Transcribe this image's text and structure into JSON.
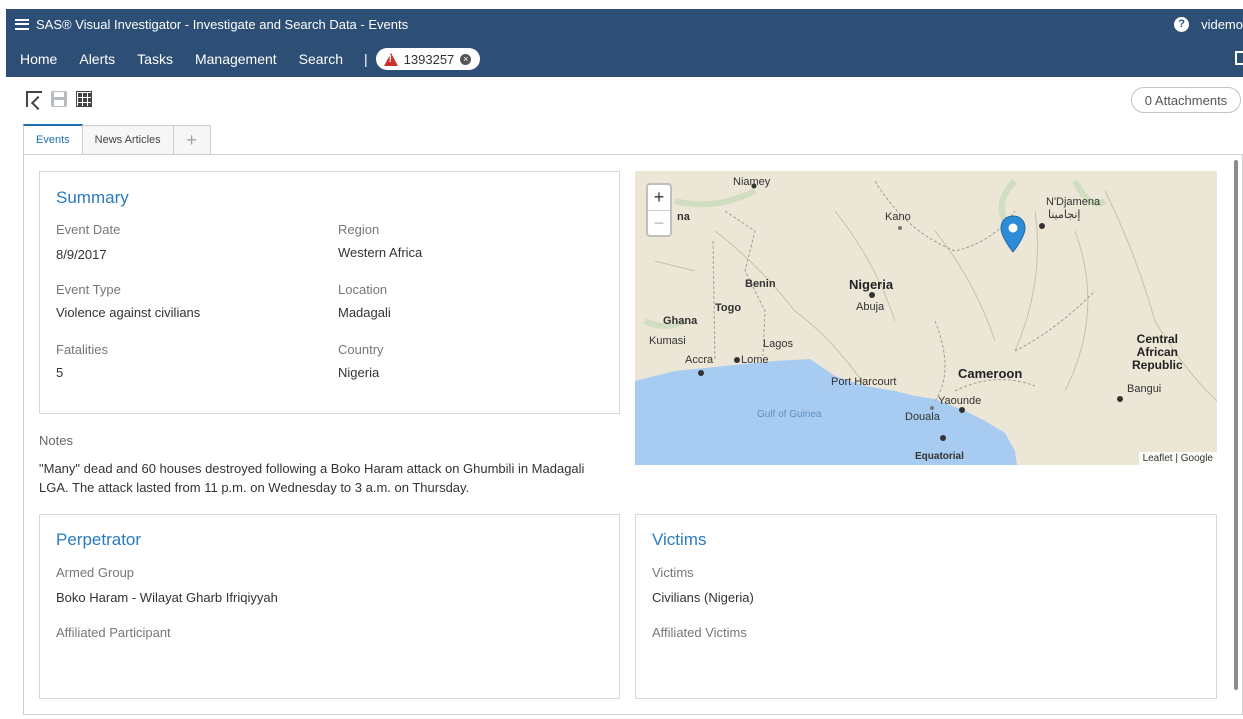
{
  "window": {
    "title": "SAS® Visual Investigator - Investigate and Search Data - Events"
  },
  "user": {
    "name": "videmo"
  },
  "nav": {
    "items": [
      "Home",
      "Alerts",
      "Tasks",
      "Management",
      "Search"
    ],
    "separator": "|",
    "case_number": "1393257"
  },
  "toolbar": {
    "icons": [
      "select-icon",
      "save-icon",
      "layout-icon"
    ]
  },
  "attachments": {
    "label": "0 Attachments"
  },
  "tabs": {
    "items": [
      "Events",
      "News Articles"
    ],
    "active": "Events",
    "add": "+"
  },
  "summary": {
    "title": "Summary",
    "event_date_label": "Event Date",
    "event_date": "8/9/2017",
    "event_type_label": "Event Type",
    "event_type": "Violence against civilians",
    "fatalities_label": "Fatalities",
    "fatalities": "5",
    "region_label": "Region",
    "region": "Western Africa",
    "location_label": "Location",
    "location": "Madagali",
    "country_label": "Country",
    "country": "Nigeria"
  },
  "map": {
    "zoom_in": "+",
    "zoom_out": "−",
    "attribution": "Leaflet | Google",
    "labels": {
      "niamey": "Niamey",
      "kano": "Kano",
      "ndjamena": "N'Djamena",
      "ndjamena_ar": "إنجامينا",
      "benin": "Benin",
      "nigeria": "Nigeria",
      "togo": "Togo",
      "abuja": "Abuja",
      "ghana": "Ghana",
      "kumasi": "Kumasi",
      "lagos": "Lagos",
      "accra": "Accra",
      "lome": "Lome",
      "port_harcourt": "Port Harcourt",
      "cameroon": "Cameroon",
      "car": "Central African Republic",
      "car_1": "Central",
      "car_2": "African",
      "car_3": "Republic",
      "bangui": "Bangui",
      "yaounde": "Yaounde",
      "douala": "Douala",
      "gulf": "Gulf of Guinea",
      "equatorial": "Equatorial",
      "na": "na"
    },
    "water_color": "#a8ccf1",
    "land_color": "#ebe6d6",
    "marker_color": "#2d8cd8"
  },
  "notes": {
    "label": "Notes",
    "text": "\"Many\" dead and 60 houses destroyed following a Boko Haram attack on Ghumbili in Madagali LGA. The attack lasted from 11 p.m. on Wednesday to 3 a.m. on Thursday."
  },
  "perpetrator": {
    "title": "Perpetrator",
    "armed_group_label": "Armed Group",
    "armed_group": "Boko Haram - Wilayat Gharb Ifriqiyyah",
    "affiliated_label": "Affiliated Participant"
  },
  "victims": {
    "title": "Victims",
    "victims_label": "Victims",
    "victims": "Civilians (Nigeria)",
    "affiliated_label": "Affiliated Victims"
  }
}
